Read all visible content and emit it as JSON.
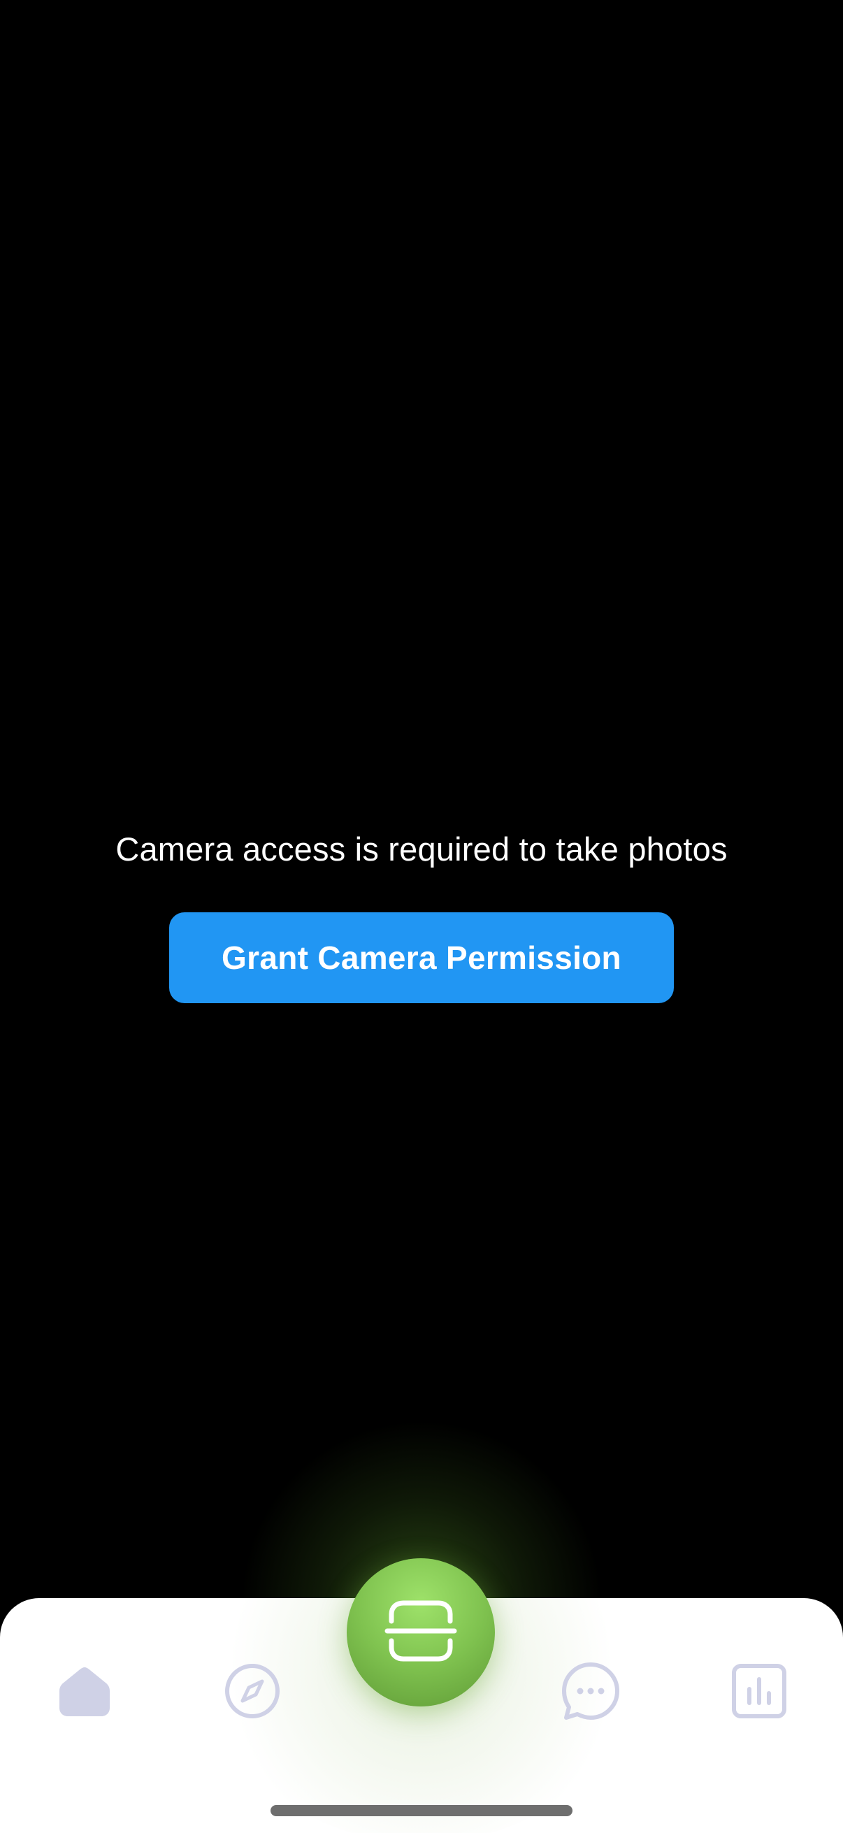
{
  "camera": {
    "message": "Camera access is required to take photos",
    "grant_button_label": "Grant Camera Permission"
  },
  "colors": {
    "background": "#000000",
    "primary_button": "#2196F3",
    "scan_button_green": "#7FC24F",
    "tab_icon_inactive": "#CFD1E6",
    "tab_bar_background": "#FFFFFF"
  },
  "tab_bar": {
    "items": [
      {
        "icon": "home-icon",
        "active": true
      },
      {
        "icon": "compass-icon",
        "active": false
      },
      {
        "icon": "scan-icon",
        "center": true
      },
      {
        "icon": "chat-bubble-icon",
        "active": false
      },
      {
        "icon": "bar-chart-icon",
        "active": false
      }
    ]
  }
}
